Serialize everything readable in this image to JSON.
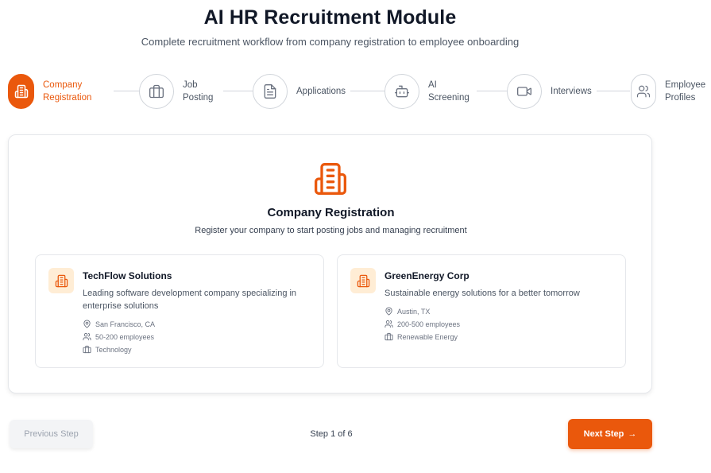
{
  "header": {
    "title": "AI HR Recruitment Module",
    "subtitle": "Complete recruitment workflow from company registration to employee onboarding"
  },
  "steps": [
    {
      "label": "Company\nRegistration",
      "icon": "building-icon",
      "active": true
    },
    {
      "label": "Job\nPosting",
      "icon": "briefcase-icon",
      "active": false
    },
    {
      "label": "Applications",
      "icon": "document-icon",
      "active": false
    },
    {
      "label": "AI\nScreening",
      "icon": "bot-icon",
      "active": false
    },
    {
      "label": "Interviews",
      "icon": "video-icon",
      "active": false
    },
    {
      "label": "Employee\nProfiles",
      "icon": "users-icon",
      "active": false
    }
  ],
  "section": {
    "icon": "building-icon",
    "title": "Company Registration",
    "subtitle": "Register your company to start posting jobs and managing recruitment"
  },
  "companies": [
    {
      "name": "TechFlow Solutions",
      "description": "Leading software development company specializing in enterprise solutions",
      "location": "San Francisco, CA",
      "size": "50-200 employees",
      "industry": "Technology"
    },
    {
      "name": "GreenEnergy Corp",
      "description": "Sustainable energy solutions for a better tomorrow",
      "location": "Austin, TX",
      "size": "200-500 employees",
      "industry": "Renewable Energy"
    }
  ],
  "footer": {
    "prev_label": "Previous Step",
    "step_counter": "Step 1 of 6",
    "next_label": "Next Step"
  },
  "colors": {
    "accent": "#ea580c",
    "accent_light": "#ffedd5",
    "border": "#e5e7eb",
    "muted_text": "#6b7280"
  }
}
